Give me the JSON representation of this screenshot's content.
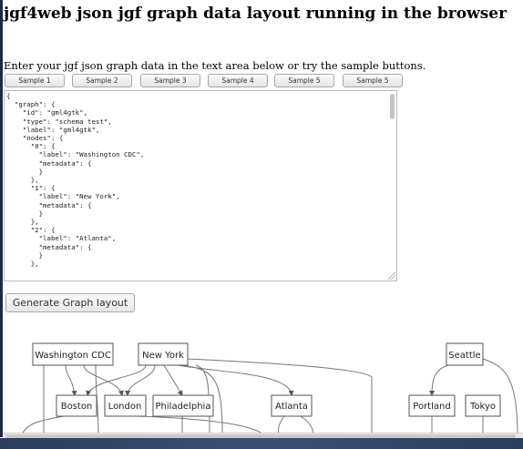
{
  "page": {
    "title": "jgf4web json jgf graph data layout running in the browser",
    "intro": "Enter your jgf json graph data in the text area below or try the sample buttons."
  },
  "samples": [
    {
      "label": "Sample 1"
    },
    {
      "label": "Sample 2"
    },
    {
      "label": "Sample 3"
    },
    {
      "label": "Sample 4"
    },
    {
      "label": "Sample 5"
    },
    {
      "label": "Sample 5"
    }
  ],
  "editor": {
    "text": "{\n  \"graph\": {\n    \"id\": \"gml4gtk\",\n    \"type\": \"schema test\",\n    \"label\": \"gml4gtk\",\n    \"nodes\": {\n      \"0\": {\n        \"label\": \"Washington CDC\",\n        \"metadata\": {\n        }\n      },\n      \"1\": {\n        \"label\": \"New York\",\n        \"metadata\": {\n        }\n      },\n      \"2\": {\n        \"label\": \"Atlanta\",\n        \"metadata\": {\n        }\n      },"
  },
  "generate_button": "Generate Graph layout",
  "graph": {
    "nodes": [
      {
        "id": "washington",
        "label": "Washington CDC"
      },
      {
        "id": "newyork",
        "label": "New York"
      },
      {
        "id": "seattle",
        "label": "Seattle"
      },
      {
        "id": "boston",
        "label": "Boston"
      },
      {
        "id": "london",
        "label": "London"
      },
      {
        "id": "philadelphia",
        "label": "Philadelphia"
      },
      {
        "id": "atlanta",
        "label": "Atlanta"
      },
      {
        "id": "portland",
        "label": "Portland"
      },
      {
        "id": "tokyo",
        "label": "Tokyo"
      }
    ]
  },
  "colors": {
    "taskbar": "#2b3e5e",
    "node_stroke": "#555555",
    "edge": "#777777"
  }
}
